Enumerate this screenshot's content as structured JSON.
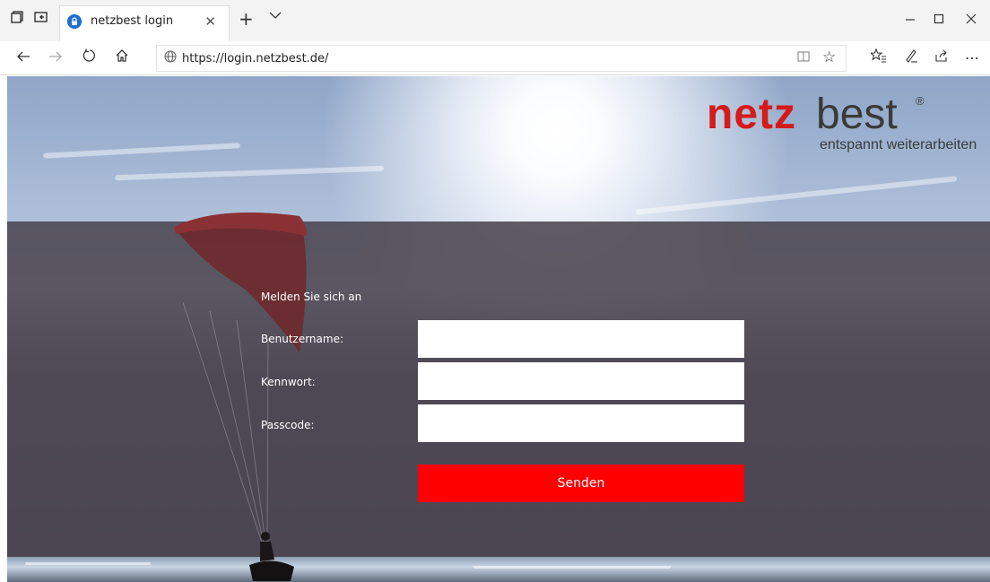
{
  "browser": {
    "tab_title": "netzbest login",
    "url": "https://login.netzbest.de/",
    "icons": {
      "tab_actions": "tab-actions-icon",
      "set_aside": "set-aside-icon",
      "favicon": "lock-icon",
      "tab_close": "close-icon",
      "new_tab": "plus-icon",
      "tab_list": "chevron-down-icon",
      "minimize": "minimize-icon",
      "maximize": "maximize-icon",
      "close": "close-icon",
      "back": "back-icon",
      "forward": "forward-icon",
      "refresh": "refresh-icon",
      "home": "home-icon",
      "site_info": "globe-icon",
      "reading_view": "reading-view-icon",
      "favorite": "star-icon",
      "favorites": "favorites-list-icon",
      "notes": "pen-icon",
      "share": "share-icon",
      "more": "more-icon"
    }
  },
  "logo": {
    "brand_red": "netz",
    "brand_dark": "best",
    "registered": "®",
    "slogan": "entspannt weiterarbeiten",
    "colors": {
      "red": "#d41a1a",
      "dark": "#3a3a3a"
    }
  },
  "form": {
    "heading": "Melden Sie sich an",
    "username_label": "Benutzername:",
    "password_label": "Kennwort:",
    "passcode_label": "Passcode:",
    "username_value": "",
    "password_value": "",
    "passcode_value": "",
    "submit_label": "Senden",
    "colors": {
      "submit": "#ff0000",
      "overlay": "#48424d"
    }
  }
}
